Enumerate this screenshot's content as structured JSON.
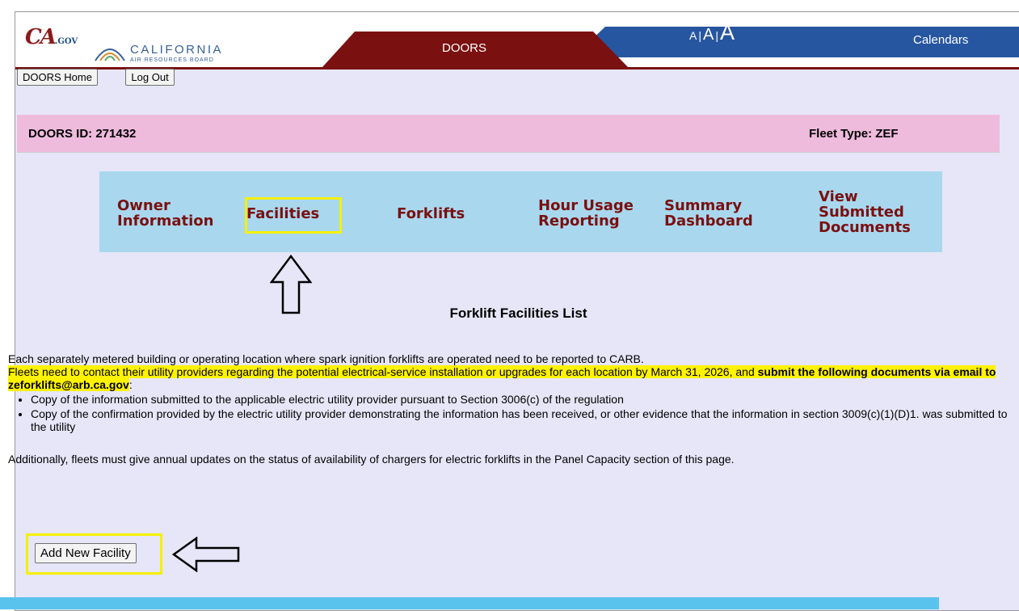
{
  "header": {
    "ca_logo_text": "CA",
    "ca_logo_sub": ".GOV",
    "arb_name": "CALIFORNIA",
    "arb_sub": "AIR RESOURCES BOARD",
    "app_tab": "DOORS",
    "font_small": "A",
    "font_medium": "A",
    "font_large": "A",
    "sep": "|",
    "calendars_link": "Calendars"
  },
  "toolbar": {
    "home_label": "DOORS Home",
    "logout_label": "Log Out"
  },
  "idbar": {
    "doors_id": "DOORS ID: 271432",
    "fleet_type": "Fleet Type: ZEF"
  },
  "nav": {
    "owner_1": "Owner",
    "owner_2": "Information",
    "facilities": "Facilities",
    "forklifts": "Forklifts",
    "hour_1": "Hour Usage",
    "hour_2": "Reporting",
    "summary_1": "Summary",
    "summary_2": "Dashboard",
    "view_1": "View",
    "view_2": "Submitted",
    "view_3": "Documents"
  },
  "page": {
    "title": "Forklift Facilities List",
    "intro": "Each separately metered building or operating location where spark ignition forklifts are operated need to be reported to CARB.",
    "highlight_plain": "Fleets need to contact their utility providers regarding the potential electrical-service installation or upgrades for each location by March 31, 2026, and ",
    "highlight_bold": "submit the following documents via email to zeforklifts@arb.ca.gov",
    "colon": ":",
    "bullet_1": "Copy of the information submitted to the applicable electric utility provider pursuant to Section 3006(c) of the regulation",
    "bullet_2": "Copy of the confirmation provided by the electric utility provider demonstrating the information has been received, or other evidence that the information in section 3009(c)(1)(D)1. was submitted to the utility",
    "additional": "Additionally, fleets must give annual updates on the status of availability of chargers for electric forklifts in the Panel Capacity section of this page.",
    "add_button": "Add New Facility"
  },
  "colors": {
    "header_red": "#7a1010",
    "header_blue": "#2756a0",
    "nav_bg": "#a9d8ee",
    "id_bar": "#eebbdd",
    "highlight": "#fff200"
  }
}
